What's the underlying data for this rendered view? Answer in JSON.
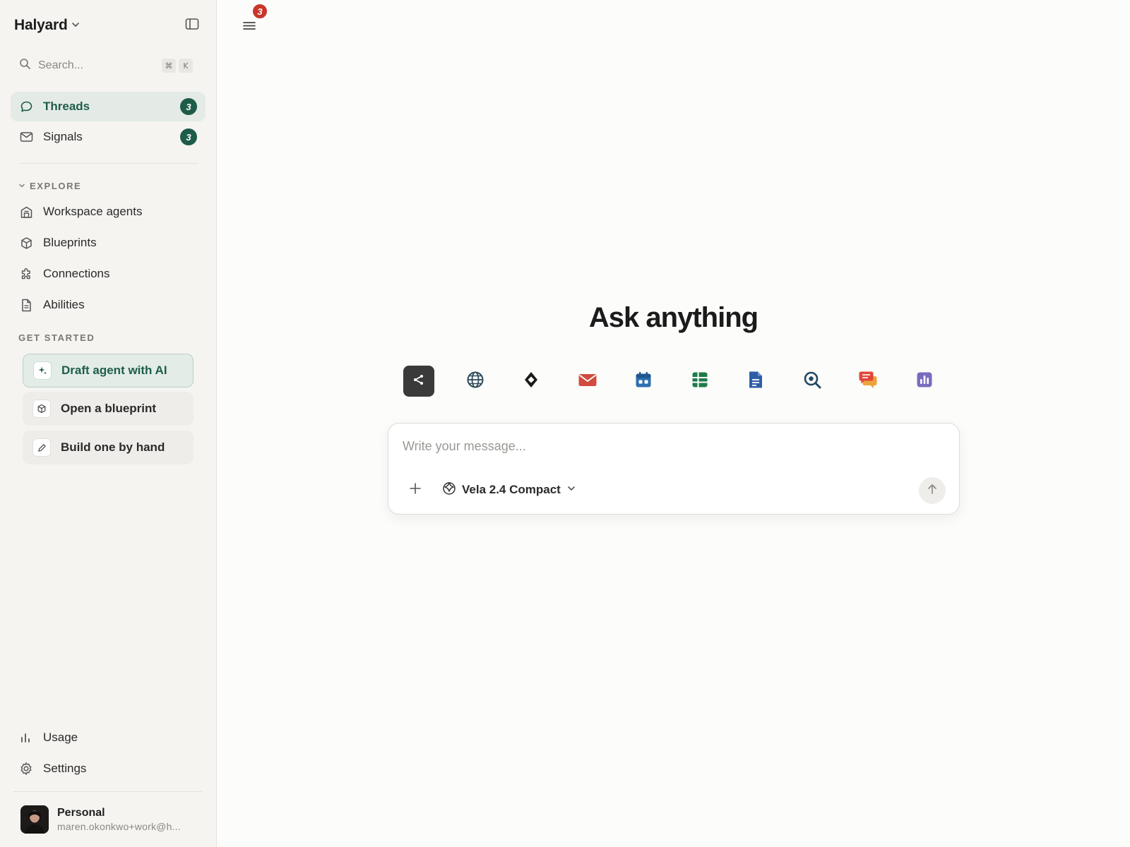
{
  "workspace": {
    "name": "Halyard"
  },
  "search": {
    "placeholder": "Search...",
    "shortcut_mod": "⌘",
    "shortcut_key": "K"
  },
  "nav": {
    "threads": {
      "label": "Threads",
      "count": "3"
    },
    "signals": {
      "label": "Signals",
      "count": "3"
    }
  },
  "explore": {
    "label": "EXPLORE",
    "items": [
      {
        "label": "Workspace agents",
        "icon": "building-icon"
      },
      {
        "label": "Blueprints",
        "icon": "cube-icon"
      },
      {
        "label": "Connections",
        "icon": "puzzle-icon"
      },
      {
        "label": "Abilities",
        "icon": "document-icon"
      }
    ]
  },
  "get_started": {
    "label": "GET STARTED",
    "items": [
      {
        "label": "Draft agent with AI",
        "icon": "sparkle-icon"
      },
      {
        "label": "Open a blueprint",
        "icon": "cube-icon"
      },
      {
        "label": "Build one by hand",
        "icon": "pencil-icon"
      }
    ]
  },
  "bottom_nav": {
    "usage": "Usage",
    "settings": "Settings"
  },
  "profile": {
    "name": "Personal",
    "email": "maren.okonkwo+work@h..."
  },
  "main": {
    "menu_badge": "3",
    "title": "Ask anything",
    "tools": [
      {
        "name": "share-tool-icon",
        "color": "#3a3a3a"
      },
      {
        "name": "globe-icon",
        "color": "#2d4a5a"
      },
      {
        "name": "diamond-icon",
        "color": "#1a1a1a"
      },
      {
        "name": "mail-icon",
        "color": "#d24b3f"
      },
      {
        "name": "calendar-icon",
        "color": "#2e6fb0"
      },
      {
        "name": "spreadsheet-icon",
        "color": "#1e7a4a"
      },
      {
        "name": "doc-icon",
        "color": "#2f5ea8"
      },
      {
        "name": "search-lens-icon",
        "color": "#1f4a66"
      },
      {
        "name": "chat-icon",
        "color": "#e0483a"
      },
      {
        "name": "analytics-icon",
        "color": "#7b6bbf"
      }
    ],
    "composer": {
      "placeholder": "Write your message...",
      "model": "Vela 2.4 Compact"
    }
  },
  "colors": {
    "accent": "#1d5c48",
    "alert": "#c8352a"
  }
}
